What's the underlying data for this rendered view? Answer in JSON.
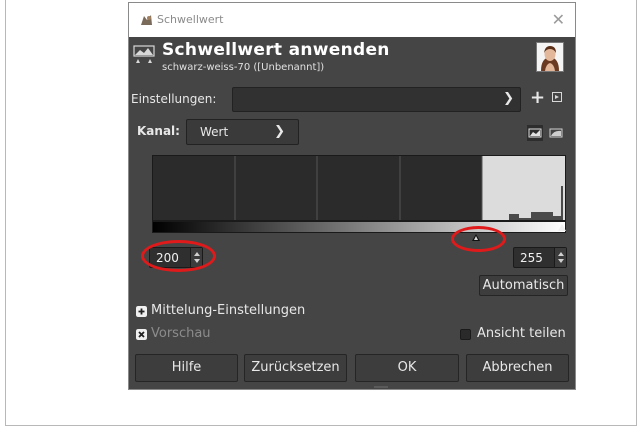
{
  "window": {
    "title": "Schwellwert"
  },
  "header": {
    "title": "Schwellwert anwenden",
    "subtitle": "schwarz-weiss-70 ([Unbenannt])"
  },
  "presets": {
    "label": "Einstellungen:",
    "value": ""
  },
  "channel": {
    "label": "Kanal:",
    "value": "Wert"
  },
  "threshold": {
    "low": "200",
    "high": "255"
  },
  "buttons": {
    "auto": "Automatisch",
    "help": "Hilfe",
    "reset": "Zurücksetzen",
    "ok": "OK",
    "cancel": "Abbrechen"
  },
  "options": {
    "blending": "Mittelung-Einstellungen",
    "preview": "Vorschau",
    "split_view": "Ansicht teilen"
  },
  "colors": {
    "dialog_bg": "#454545",
    "highlight": "#e01a1a",
    "histogram_bg": "#2b2b2b",
    "selected_range": "#dcdcdc"
  }
}
